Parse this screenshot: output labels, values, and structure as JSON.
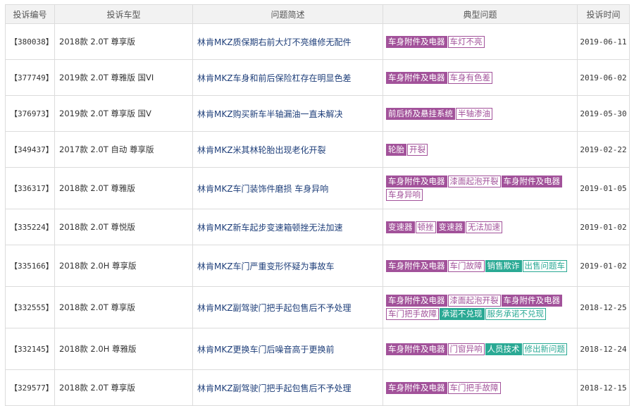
{
  "headers": [
    "投诉编号",
    "投诉车型",
    "问题简述",
    "典型问题",
    "投诉时间"
  ],
  "colors": {
    "purple": "#a2529a",
    "teal": "#2aa994"
  },
  "rows": [
    {
      "id": "【380038】",
      "model": "2018款 2.0T 尊享版",
      "desc": "林肯MKZ质保期右前大灯不亮维修无配件",
      "date": "2019-06-11",
      "tags": [
        {
          "text": "车身附件及电器",
          "style": "p-fill"
        },
        {
          "text": "车灯不亮",
          "style": "p-out"
        }
      ]
    },
    {
      "id": "【377749】",
      "model": "2019款 2.0T 尊雅版 国VI",
      "desc": "林肯MKZ车身和前后保险杠存在明显色差",
      "date": "2019-06-02",
      "tags": [
        {
          "text": "车身附件及电器",
          "style": "p-fill"
        },
        {
          "text": "车身有色差",
          "style": "p-out"
        }
      ]
    },
    {
      "id": "【376973】",
      "model": "2019款 2.0T 尊享版 国V",
      "desc": "林肯MKZ购买新车半轴漏油一直未解决",
      "date": "2019-05-30",
      "tags": [
        {
          "text": "前后桥及悬挂系统",
          "style": "p-fill"
        },
        {
          "text": "半轴渗油",
          "style": "p-out"
        }
      ]
    },
    {
      "id": "【349437】",
      "model": "2017款 2.0T 自动 尊享版",
      "desc": "林肯MKZ米其林轮胎出现老化开裂",
      "date": "2019-02-22",
      "tags": [
        {
          "text": "轮胎",
          "style": "p-fill"
        },
        {
          "text": "开裂",
          "style": "p-out"
        }
      ]
    },
    {
      "id": "【336317】",
      "model": "2018款 2.0T 尊雅版",
      "desc": "林肯MKZ车门装饰件磨损 车身异响",
      "date": "2019-01-05",
      "tags": [
        {
          "text": "车身附件及电器",
          "style": "p-fill"
        },
        {
          "text": "漆面起泡开裂",
          "style": "p-out"
        },
        {
          "text": "车身附件及电器",
          "style": "p-fill"
        },
        {
          "text": "车身异响",
          "style": "p-out"
        }
      ]
    },
    {
      "id": "【335224】",
      "model": "2018款 2.0T 尊悦版",
      "desc": "林肯MKZ新车起步变速箱顿挫无法加速",
      "date": "2019-01-02",
      "tags": [
        {
          "text": "变速器",
          "style": "p-fill"
        },
        {
          "text": "顿挫",
          "style": "p-out"
        },
        {
          "text": "变速器",
          "style": "p-fill"
        },
        {
          "text": "无法加速",
          "style": "p-out"
        }
      ]
    },
    {
      "id": "【335166】",
      "model": "2018款 2.0H 尊享版",
      "desc": "林肯MKZ车门严重变形怀疑为事故车",
      "date": "2019-01-02",
      "tags": [
        {
          "text": "车身附件及电器",
          "style": "p-fill"
        },
        {
          "text": "车门故障",
          "style": "p-out"
        },
        {
          "text": "销售欺诈",
          "style": "t-fill"
        },
        {
          "text": "出售问题车",
          "style": "t-out"
        }
      ]
    },
    {
      "id": "【332555】",
      "model": "2018款 2.0T 尊享版",
      "desc": "林肯MKZ副驾驶门把手起包售后不予处理",
      "date": "2018-12-25",
      "tags": [
        {
          "text": "车身附件及电器",
          "style": "p-fill"
        },
        {
          "text": "漆面起泡开裂",
          "style": "p-out"
        },
        {
          "text": "车身附件及电器",
          "style": "p-fill"
        },
        {
          "text": "车门把手故障",
          "style": "p-out"
        },
        {
          "text": "承诺不兑现",
          "style": "t-fill"
        },
        {
          "text": "服务承诺不兑现",
          "style": "t-out"
        }
      ]
    },
    {
      "id": "【332145】",
      "model": "2018款 2.0H 尊雅版",
      "desc": "林肯MKZ更换车门后噪音高于更换前",
      "date": "2018-12-24",
      "tags": [
        {
          "text": "车身附件及电器",
          "style": "p-fill"
        },
        {
          "text": "门窗异响",
          "style": "p-out"
        },
        {
          "text": "人员技术",
          "style": "t-fill"
        },
        {
          "text": "修出新问题",
          "style": "t-out"
        }
      ]
    },
    {
      "id": "【329577】",
      "model": "2018款 2.0T 尊享版",
      "desc": "林肯MKZ副驾驶门把手起包售后不予处理",
      "date": "2018-12-15",
      "tags": [
        {
          "text": "车身附件及电器",
          "style": "p-fill"
        },
        {
          "text": "车门把手故障",
          "style": "p-out"
        }
      ]
    }
  ]
}
